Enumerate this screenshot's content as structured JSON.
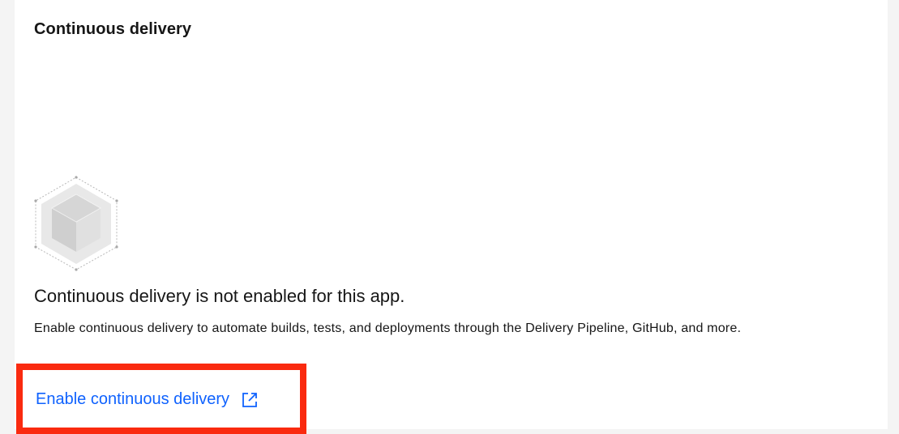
{
  "card": {
    "title": "Continuous delivery"
  },
  "empty_state": {
    "illustration_icon": "cube-icon",
    "heading": "Continuous delivery is not enabled for this app.",
    "description": "Enable continuous delivery to automate builds, tests, and deployments through the Delivery Pipeline, GitHub, and more."
  },
  "action": {
    "label": "Enable continuous delivery",
    "icon": "launch-icon",
    "link_color": "#0f62fe",
    "highlight_color": "#fa2a0f"
  }
}
